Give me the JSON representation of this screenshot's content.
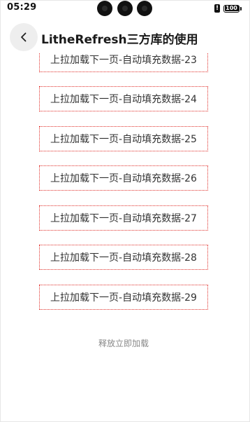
{
  "status_bar": {
    "time": "05:29",
    "battery": "100",
    "alert_icon": "!",
    "icons": [
      "front-camera-icon",
      "alert-icon",
      "battery-icon"
    ]
  },
  "header": {
    "back_icon": "chevron-left-icon",
    "title": "LitheRefresh三方库的使用"
  },
  "list": {
    "items": [
      "上拉加载下一页-自动填充数据-23",
      "上拉加载下一页-自动填充数据-24",
      "上拉加载下一页-自动填充数据-25",
      "上拉加载下一页-自动填充数据-26",
      "上拉加载下一页-自动填充数据-27",
      "上拉加载下一页-自动填充数据-28",
      "上拉加载下一页-自动填充数据-29"
    ]
  },
  "footer": {
    "load_hint": "释放立即加载"
  },
  "colors": {
    "item_border": "#e0302b",
    "item_text": "#333333",
    "hint_text": "#888888",
    "back_button_bg": "#eeeeee"
  }
}
